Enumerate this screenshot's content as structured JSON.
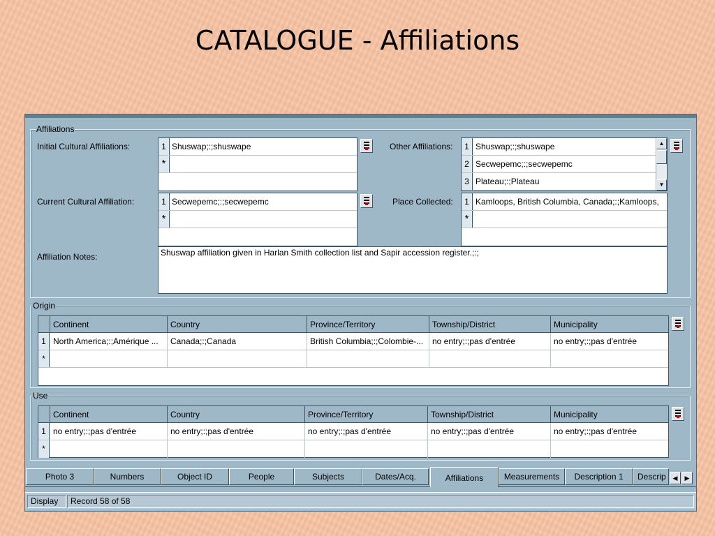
{
  "slide": {
    "title": "CATALOGUE - Affiliations"
  },
  "affiliations": {
    "legend": "Affiliations",
    "initial_label": "Initial Cultural Affiliations:",
    "initial_rows": [
      {
        "num": "1",
        "value": "Shuswap;:;shuswape"
      }
    ],
    "current_label": "Current Cultural Affiliation:",
    "current_rows": [
      {
        "num": "1",
        "value": "Secwepemc;:;secwepemc"
      }
    ],
    "other_label": "Other Affiliations:",
    "other_rows": [
      {
        "num": "1",
        "value": "Shuswap;:;shuswape"
      },
      {
        "num": "2",
        "value": "Secwepemc;:;secwepemc"
      },
      {
        "num": "3",
        "value": "Plateau;:;Plateau"
      }
    ],
    "place_label": "Place Collected:",
    "place_rows": [
      {
        "num": "1",
        "value": "Kamloops, British Columbia, Canada;:;Kamloops,"
      }
    ],
    "notes_label": "Affiliation Notes:",
    "notes_value": "Shuswap affiliation given in Harlan Smith collection list and Sapir accession register.;:;",
    "new_row_marker": "*"
  },
  "origin": {
    "legend": "Origin",
    "columns": [
      "Continent",
      "Country",
      "Province/Territory",
      "Township/District",
      "Municipality"
    ],
    "rows": [
      {
        "num": "1",
        "cells": [
          "North America;:;Amérique ...",
          "Canada;:;Canada",
          "British Columbia;:;Colombie-...",
          "no entry;:;pas d'entrée",
          "no entry;:;pas d'entrée"
        ]
      }
    ]
  },
  "use": {
    "legend": "Use",
    "columns": [
      "Continent",
      "Country",
      "Province/Territory",
      "Township/District",
      "Municipality"
    ],
    "rows": [
      {
        "num": "1",
        "cells": [
          "no entry;:;pas d'entrée",
          "no entry;:;pas d'entrée",
          "no entry;:;pas d'entrée",
          "no entry;:;pas d'entrée",
          "no entry;:;pas d'entrée"
        ]
      }
    ]
  },
  "tabs": [
    {
      "label": "Photo 3"
    },
    {
      "label": "Numbers"
    },
    {
      "label": "Object ID"
    },
    {
      "label": "People"
    },
    {
      "label": "Subjects"
    },
    {
      "label": "Dates/Acq."
    },
    {
      "label": "Affiliations",
      "active": true
    },
    {
      "label": "Measurements"
    },
    {
      "label": "Description 1"
    },
    {
      "label": "Descrip"
    }
  ],
  "status": {
    "mode": "Display",
    "record": "Record 58 of 58"
  },
  "icons": {
    "subform_button": "list-edit-icon",
    "scroll_up": "scroll-up-icon",
    "scroll_down": "scroll-down-icon",
    "tab_left": "arrow-left-icon",
    "tab_right": "arrow-right-icon"
  },
  "colors": {
    "background": "#f9c4a4",
    "window": "#9fb8c8",
    "field": "#ffffff"
  }
}
